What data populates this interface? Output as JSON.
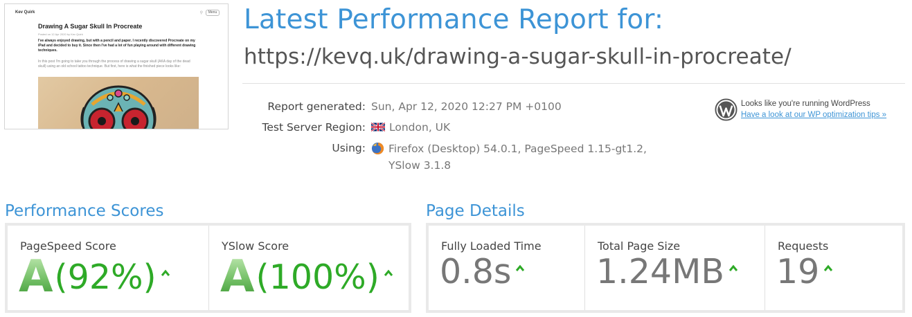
{
  "thumbnail": {
    "site_name": "Kev Quirk",
    "menu_label": "Menu",
    "post_title": "Drawing A Sugar Skull In Procreate",
    "post_meta": "Posted on 12 Apr 2020 by Kev Quirk",
    "paragraph_1": "I've always enjoyed drawing, but with a pencil and paper. I recently discovered Procreate on my iPad and decided to buy it. Since then I've had a lot of fun playing around with different drawing techniques.",
    "paragraph_2": "In this post I'm going to take you through the process of drawing a sugar skull (AKA day of the dead skull) using an old school tattoo technique. But first, here is what the finished piece looks like:"
  },
  "header": {
    "title": "Latest Performance Report for:",
    "url": "https://kevq.uk/drawing-a-sugar-skull-in-procreate/"
  },
  "report_info": {
    "generated_label": "Report generated:",
    "generated_value": "Sun, Apr 12, 2020 12:27 PM +0100",
    "region_label": "Test Server Region:",
    "region_value": "London, UK",
    "region_icon": "uk-flag-icon",
    "using_label": "Using:",
    "using_value_line1": "Firefox (Desktop) 54.0.1, PageSpeed 1.15-gt1.2,",
    "using_value_line2": "YSlow 3.1.8",
    "using_icon": "firefox-icon"
  },
  "wordpress": {
    "icon": "wordpress-icon",
    "message": "Looks like you're running WordPress",
    "link_text": "Have a look at our WP optimization tips »"
  },
  "performance_scores": {
    "title": "Performance Scores",
    "items": [
      {
        "label": "PageSpeed Score",
        "grade": "A",
        "value": "(92%)",
        "trend": "up"
      },
      {
        "label": "YSlow Score",
        "grade": "A",
        "value": "(100%)",
        "trend": "up"
      }
    ]
  },
  "page_details": {
    "title": "Page Details",
    "items": [
      {
        "label": "Fully Loaded Time",
        "value": "0.8s",
        "trend": "up"
      },
      {
        "label": "Total Page Size",
        "value": "1.24MB",
        "trend": "up"
      },
      {
        "label": "Requests",
        "value": "19",
        "trend": "up"
      }
    ]
  },
  "colors": {
    "accent_blue": "#3d94d6",
    "score_green": "#2eaa27",
    "text_gray": "#777777"
  }
}
